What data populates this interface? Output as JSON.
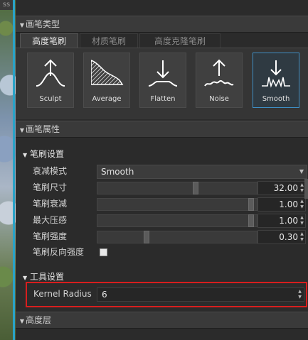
{
  "viewport": {
    "corner_label": "ss"
  },
  "brush_type": {
    "header": "画笔类型",
    "tabs": [
      {
        "label": "高度笔刷",
        "active": true
      },
      {
        "label": "材质笔刷",
        "active": false
      },
      {
        "label": "高度克隆笔刷",
        "active": false
      }
    ],
    "brushes": [
      {
        "label": "Sculpt",
        "icon": "sculpt-icon",
        "selected": false
      },
      {
        "label": "Average",
        "icon": "average-icon",
        "selected": false
      },
      {
        "label": "Flatten",
        "icon": "flatten-icon",
        "selected": false
      },
      {
        "label": "Noise",
        "icon": "noise-icon",
        "selected": false
      },
      {
        "label": "Smooth",
        "icon": "smooth-icon",
        "selected": true
      }
    ]
  },
  "brush_props": {
    "header": "画笔属性",
    "brush_settings": {
      "header": "笔刷设置",
      "falloff_mode_label": "衰减模式",
      "falloff_mode_value": "Smooth",
      "size_label": "笔刷尺寸",
      "size_value": "32.00",
      "size_fraction": 0.62,
      "falloff_label": "笔刷衰减",
      "falloff_value": "1.00",
      "falloff_fraction": 0.98,
      "max_pressure_label": "最大压感",
      "max_pressure_value": "1.00",
      "max_pressure_fraction": 0.98,
      "strength_label": "笔刷强度",
      "strength_value": "0.30",
      "strength_fraction": 0.3,
      "invert_label": "笔刷反向强度",
      "invert_checked": false
    },
    "tool_settings": {
      "header": "工具设置",
      "kernel_radius_label": "Kernel Radius",
      "kernel_radius_value": "6"
    }
  },
  "height_layer": {
    "header": "高度层"
  },
  "colors": {
    "accent": "#3e8ec5",
    "highlight": "#d81e1e"
  }
}
